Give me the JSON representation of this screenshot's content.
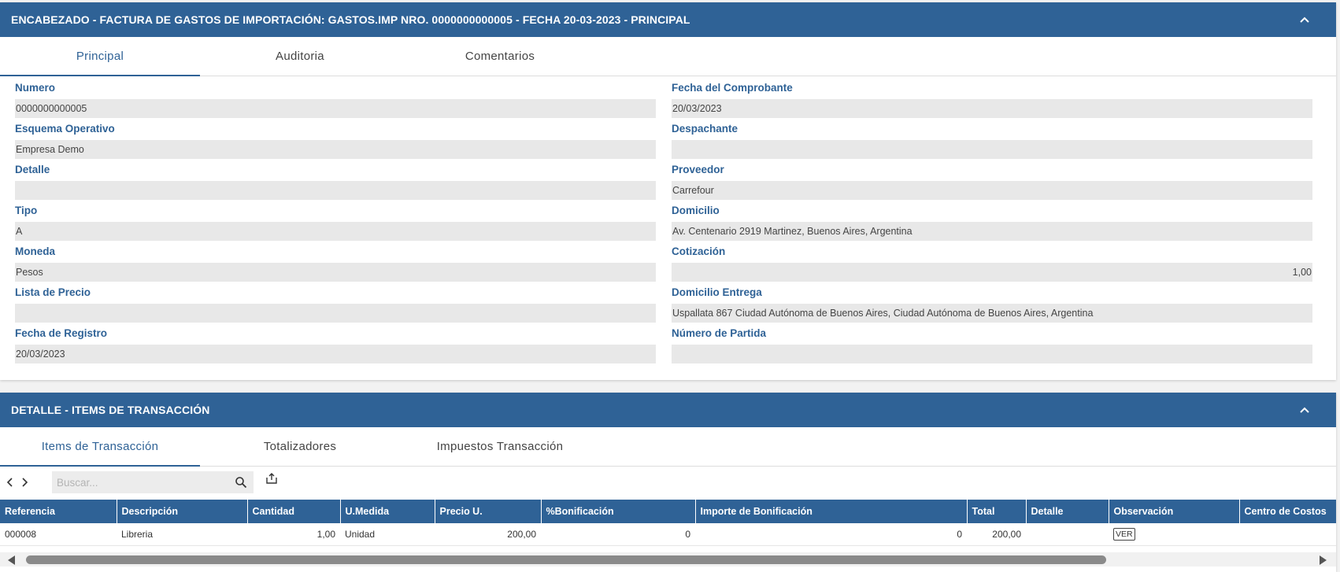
{
  "header_panel": {
    "title": "ENCABEZADO - FACTURA DE GASTOS DE IMPORTACIÓN: GASTOS.IMP NRO. 0000000000005 - FECHA 20-03-2023 - PRINCIPAL",
    "tabs": [
      {
        "label": "Principal",
        "active": true
      },
      {
        "label": "Auditoria",
        "active": false
      },
      {
        "label": "Comentarios",
        "active": false
      }
    ],
    "left_fields": [
      {
        "label": "Numero",
        "value": "0000000000005"
      },
      {
        "label": "Esquema Operativo",
        "value": "Empresa Demo"
      },
      {
        "label": "Detalle",
        "value": ""
      },
      {
        "label": "Tipo",
        "value": "A"
      },
      {
        "label": "Moneda",
        "value": "Pesos"
      },
      {
        "label": "Lista de Precio",
        "value": ""
      },
      {
        "label": "Fecha de Registro",
        "value": "20/03/2023"
      }
    ],
    "right_fields": [
      {
        "label": "Fecha del Comprobante",
        "value": "20/03/2023"
      },
      {
        "label": "Despachante",
        "value": ""
      },
      {
        "label": "Proveedor",
        "value": "Carrefour"
      },
      {
        "label": "Domicilio",
        "value": "Av. Centenario 2919  Martinez, Buenos Aires, Argentina"
      },
      {
        "label": "Cotización",
        "value": "1,00"
      },
      {
        "label": "Domicilio Entrega",
        "value": "Uspallata 867  Ciudad Autónoma de Buenos Aires, Ciudad Autónoma de Buenos Aires, Argentina"
      },
      {
        "label": "Número de Partida",
        "value": ""
      }
    ]
  },
  "detail_panel": {
    "title": "DETALLE - ITEMS DE TRANSACCIÓN",
    "tabs": [
      {
        "label": "Items de Transacción",
        "active": true
      },
      {
        "label": "Totalizadores",
        "active": false
      },
      {
        "label": "Impuestos Transacción",
        "active": false
      }
    ],
    "search": {
      "placeholder": "Buscar...",
      "value": ""
    },
    "columns": [
      "Referencia",
      "Descripción",
      "Cantidad",
      "U.Medida",
      "Precio U.",
      "%Bonificación",
      "Importe de Bonificación",
      "Total",
      "Detalle",
      "Observación",
      "Centro de Costos"
    ],
    "rows": [
      {
        "referencia": "000008",
        "descripcion": "Libreria",
        "cantidad": "1,00",
        "umedida": "Unidad",
        "precio": "200,00",
        "bonif_pct": "0",
        "bonif_importe": "0",
        "total": "200,00",
        "detalle": "",
        "observacion_btn": "VER",
        "centro_costos": ""
      }
    ]
  },
  "icons": {
    "collapse": "chevron-up-icon",
    "prev": "chevron-left-icon",
    "next": "chevron-right-icon",
    "search": "search-icon",
    "export": "export-icon"
  },
  "colors": {
    "primary": "#2f6296",
    "field_bg": "#e8e8e8",
    "label": "#2f6296"
  }
}
